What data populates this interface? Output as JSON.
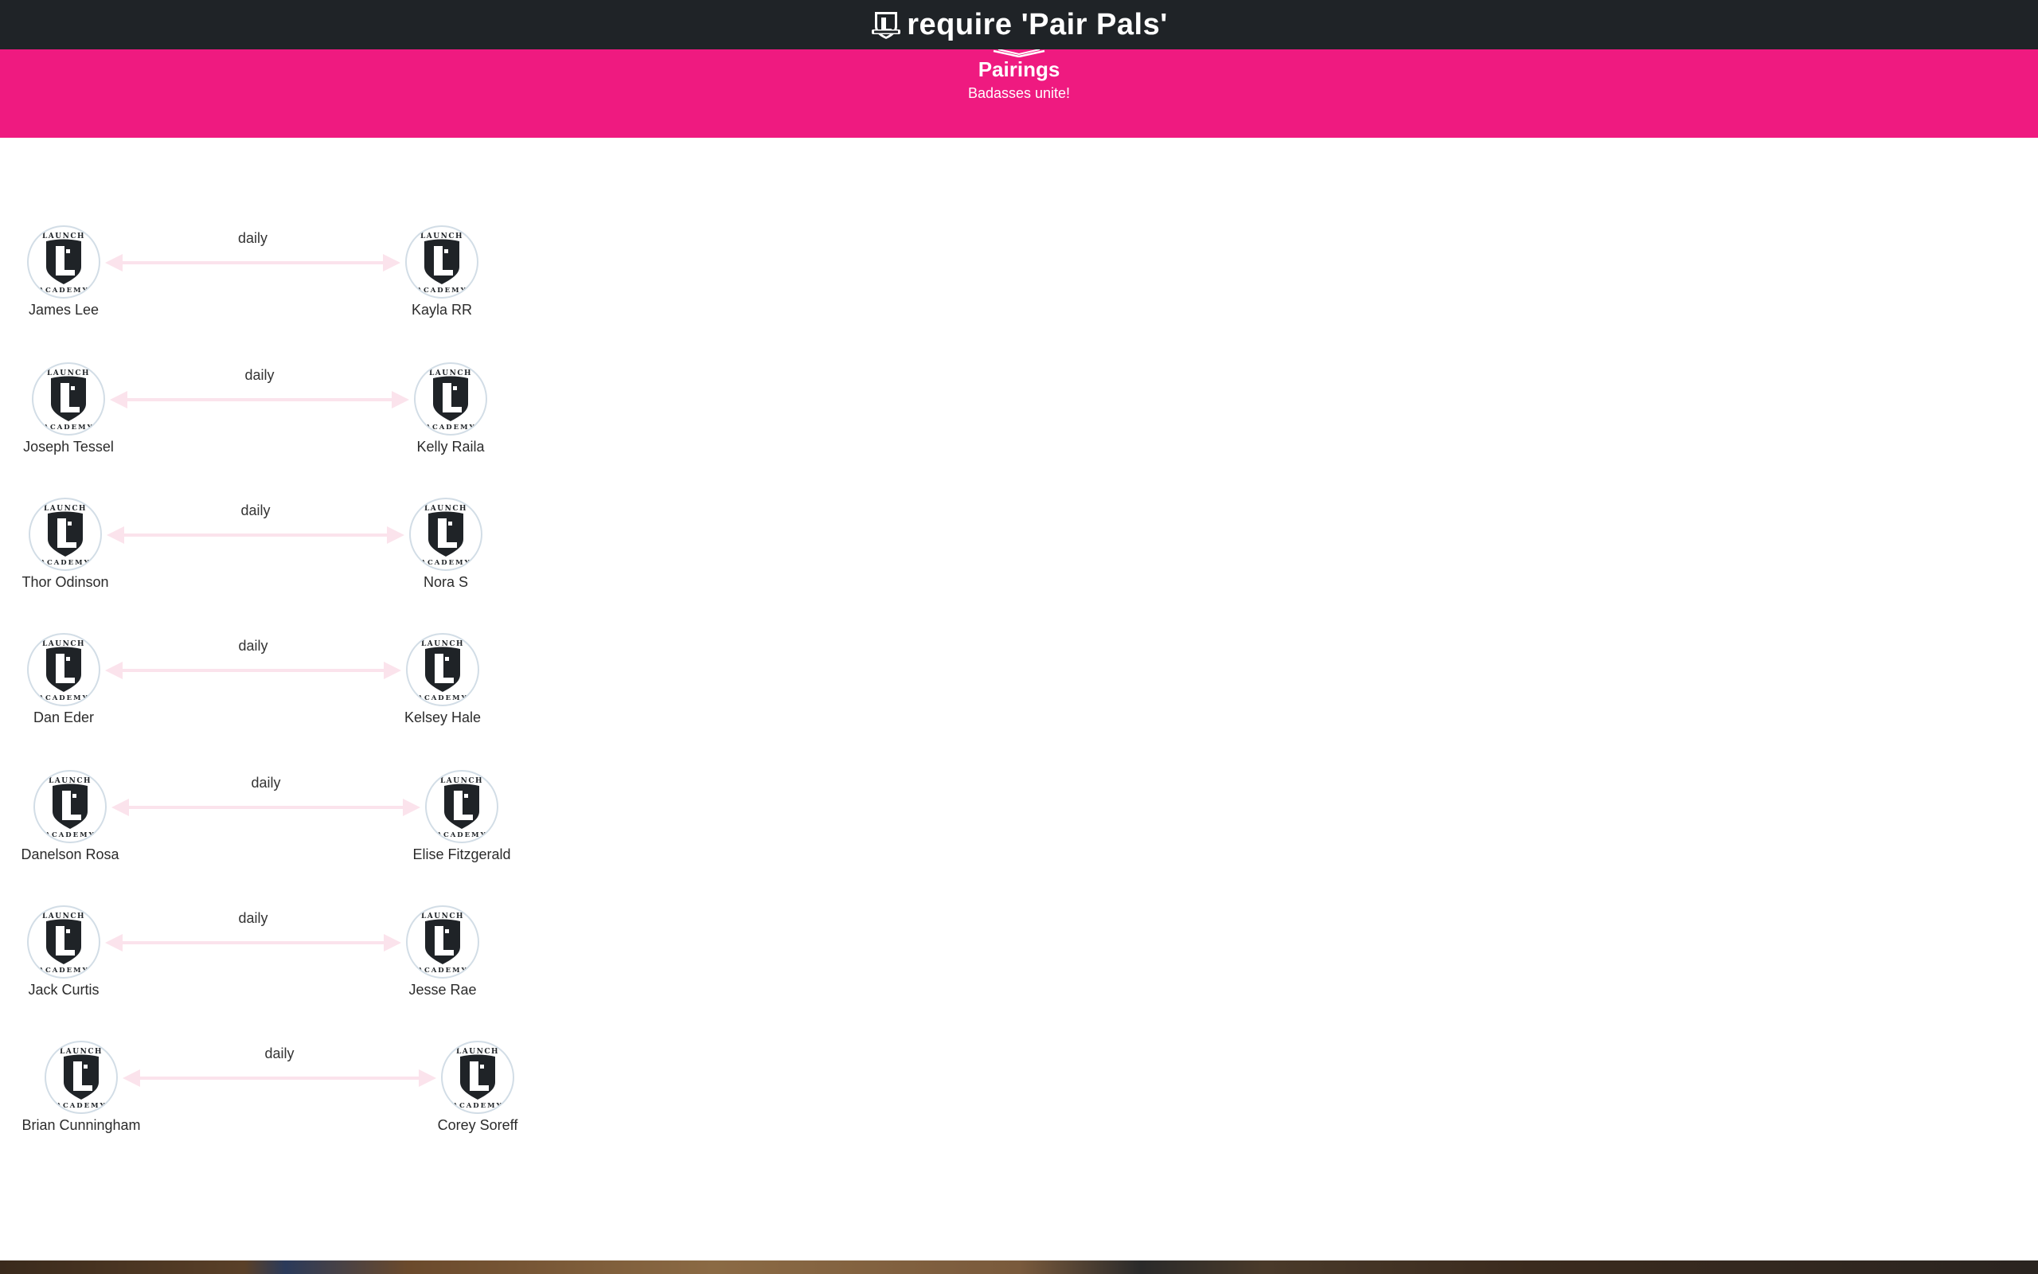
{
  "app": {
    "title": "require 'Pair Pals'"
  },
  "hero": {
    "title": "Pairings",
    "subtitle": "Badasses unite!"
  },
  "avatar_icon": "launch-academy-logo",
  "colors": {
    "topbar": "#1f2327",
    "hero": "#ef1a80",
    "arrow": "#fbe3ec"
  },
  "pairings": [
    {
      "left": "James Lee",
      "right": "Kayla RR",
      "frequency": "daily"
    },
    {
      "left": "Joseph Tessel",
      "right": "Kelly Raila",
      "frequency": "daily"
    },
    {
      "left": "Thor Odinson",
      "right": "Nora S",
      "frequency": "daily"
    },
    {
      "left": "Dan Eder",
      "right": "Kelsey Hale",
      "frequency": "daily"
    },
    {
      "left": "Danelson Rosa",
      "right": "Elise Fitzgerald",
      "frequency": "daily"
    },
    {
      "left": "Jack Curtis",
      "right": "Jesse Rae",
      "frequency": "daily"
    },
    {
      "left": "Brian Cunningham",
      "right": "Corey Soreff",
      "frequency": "daily"
    }
  ]
}
